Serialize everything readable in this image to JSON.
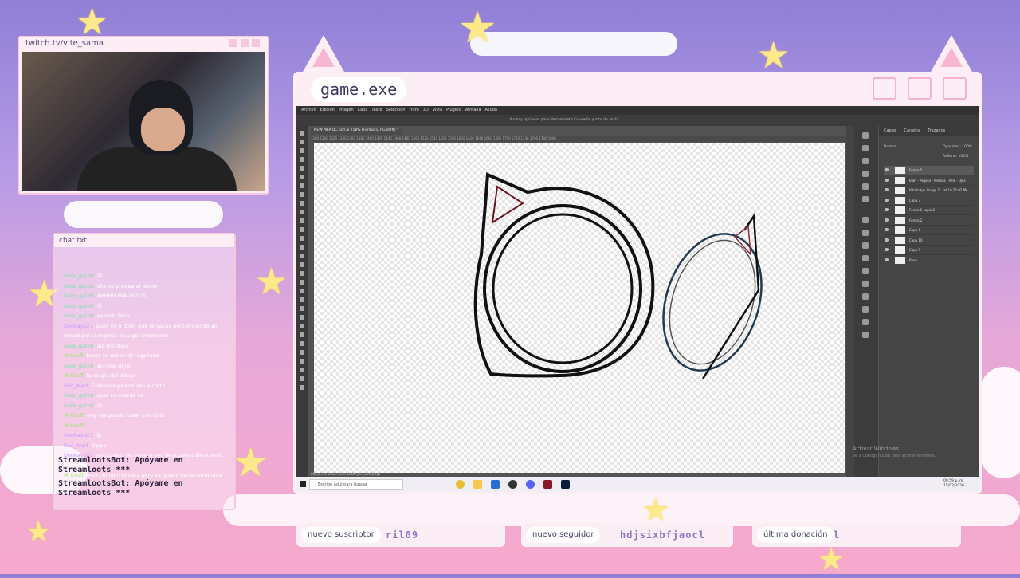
{
  "overlay": {
    "webcam_title": "twitch.tv/vite_sama",
    "chat_title": "chat.txt",
    "game_title": "game.exe"
  },
  "chat": {
    "messages": [
      {
        "user": "Gato_gato0",
        "text": "😮",
        "cls": ""
      },
      {
        "user": "Gato_gato0",
        "text": "vite se pixelea el audio",
        "cls": ""
      },
      {
        "user": "Gato_gato0",
        "text": "AHHHH MIA OIDOS",
        "cls": ""
      },
      {
        "user": "Gato_gato0",
        "text": "😮",
        "cls": ""
      },
      {
        "user": "Gato_gato0",
        "text": "ya todo bien",
        "cls": ""
      },
      {
        "user": "Donkayo27",
        "text": "pues va a dolor que te vayas pero entiendo ahi estaré por si regresa en algún momento",
        "cls": "p"
      },
      {
        "user": "Gato_gato0",
        "text": "alb me dolio",
        "cls": ""
      },
      {
        "user": "MrGruff",
        "text": "hasta yo me senti regañado",
        "cls": "g"
      },
      {
        "user": "Gato_gato0",
        "text": "ann me dolio",
        "cls": ""
      },
      {
        "user": "MrGruff",
        "text": "la magia del dibujo",
        "cls": "g"
      },
      {
        "user": "Red_Alert",
        "text": "Entonces ya nos van a corta",
        "cls": "p"
      },
      {
        "user": "Gato_gato0",
        "text": "cosa es cuerda ve",
        "cls": ""
      },
      {
        "user": "Gato_gato0",
        "text": "😮",
        "cls": ""
      },
      {
        "user": "MrGruff",
        "text": "wey me puedo casar con todo",
        "cls": "g"
      },
      {
        "user": "MrGruff",
        "text": "",
        "cls": "g"
      },
      {
        "user": "Donkayo27",
        "text": "😮",
        "cls": "p"
      },
      {
        "user": "Red_Alert",
        "text": "Sippo",
        "cls": "p"
      },
      {
        "user": "Donkayo27",
        "text": "a mi punto de vista lo veo bien pero quiero verlo terminado",
        "cls": "p"
      },
      {
        "user": "MrGruff",
        "text": "muy chingon la neta pero ya quiero verlo terminado x2",
        "cls": "g"
      }
    ],
    "bot_messages": [
      "StreamlootsBot: Apóyame en Streamloots ***",
      "StreamlootsBot: Apóyame en Streamloots ***"
    ]
  },
  "photoshop": {
    "menu": [
      "Archivo",
      "Edición",
      "Imagen",
      "Capa",
      "Texto",
      "Selección",
      "Filtro",
      "3D",
      "Vista",
      "Plugins",
      "Ventana",
      "Ayuda"
    ],
    "options_hint": "No hay opciones para Herramienta Convertir punto de ancla",
    "doc_tab": "NEW MLP OC.psd al 258% (Forma 5, RGB/8#) *",
    "status": "258,67%    1920 px x 1080 px (300 ppp)",
    "ruler": "1280  1300  1320  1340  1360  1380  1400  1420  1440  1460  1480  1500  1520  1540  1560  1580  1600  1620  1640  1660  1680  1700  1720  1740  1760  1780  1800",
    "panel_tabs": [
      "Capas",
      "Canales",
      "Trazados"
    ],
    "blend": "Normal",
    "opacity": "Opacidad: 100%",
    "fill": "Relleno: 100%",
    "layers": [
      "Forma 5",
      "Blah - Pegaso - Melana - Pink - Ojos",
      "WhatsApp Image 2... at 10.22.07 PM",
      "Capa 7",
      "Forma 2 copia 2",
      "Forma 2",
      "Capa 8",
      "Capa 10",
      "Capa 9",
      "Base"
    ],
    "activate_windows": "Activar Windows",
    "activate_hint": "Ve a Configuración para activar Windows.",
    "taskbar_search": "Escribe aquí para buscar",
    "clock_time": "09:59 p. m.",
    "clock_date": "15/02/2026"
  },
  "bottom_bars": {
    "subscriber_label": "nuevo suscriptor",
    "subscriber_value": "ril09",
    "follower_label": "nuevo seguidor",
    "follower_value": "hdjsixbfjaocl",
    "donation_label": "última donación",
    "donation_value": "l"
  },
  "colors": {
    "accent": "#f8b6d3",
    "sky_top": "#8f7fd6",
    "sky_bottom": "#f6a9cc",
    "star": "#fbe98a"
  }
}
